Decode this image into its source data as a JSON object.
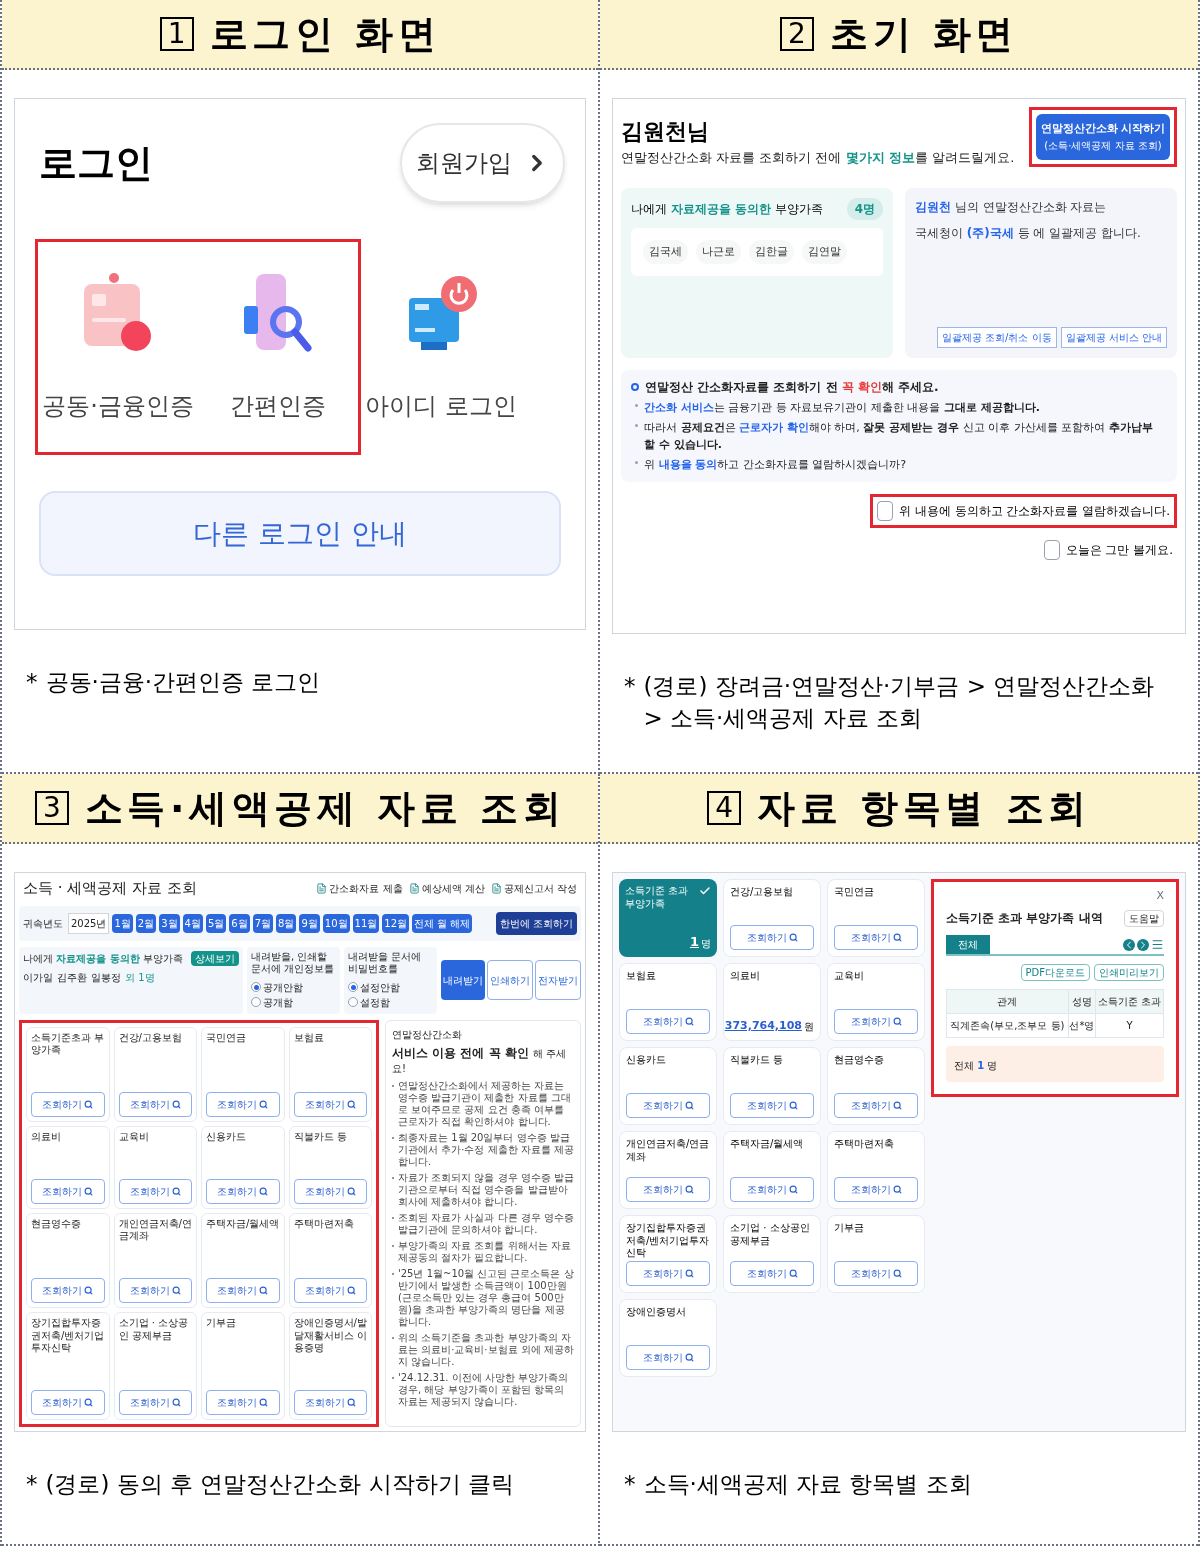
{
  "login_screen": {
    "number": "1",
    "title": "로그인 화면",
    "heading": "로그인",
    "signup_button": "회원가입",
    "method_groups": [
      {
        "highlighted": true,
        "methods": [
          {
            "label": "공동·금융인증",
            "kind": "certificate"
          },
          {
            "label": "간편인증",
            "kind": "simple"
          }
        ]
      },
      {
        "highlighted": false,
        "methods": [
          {
            "label": "아이디 로그인",
            "kind": "id"
          }
        ]
      }
    ],
    "other_login_button": "다른 로그인 안내",
    "caption": {
      "mark": "*",
      "text": "공동·금융·간편인증 로그인"
    }
  },
  "start_screen": {
    "number": "2",
    "title": "초기 화면",
    "greeting": "김원천님",
    "intro": [
      {
        "text": "연말정산간소화 자료를 조회하기 전에 "
      },
      {
        "text": "몇가지 정보",
        "color": "#14938a"
      },
      {
        "text": "를 알려드릴게요."
      }
    ],
    "start_button": {
      "label": "연말정산간소화 시작하기",
      "sublabel": "(소득·세액공제 자료 조회)",
      "highlighted": true
    },
    "dependents": {
      "heading": [
        {
          "text": "나에게 "
        },
        {
          "text": "자료제공을 동의한",
          "color": "#14938a"
        },
        {
          "text": " 부양가족"
        }
      ],
      "count": "4명",
      "names": [
        "김국세",
        "나근로",
        "김한글",
        "김연말"
      ]
    },
    "provider": {
      "lines": [
        [
          {
            "text": "김원천",
            "color": "#2563eb"
          },
          {
            "text": " 님의 연말정산간소화 자료는"
          }
        ],
        [
          {
            "text": "국세청이 "
          },
          {
            "text": "(주)국세",
            "color": "#2563eb"
          },
          {
            "text": "  등 에 일괄제공 합니다."
          }
        ]
      ],
      "buttons": [
        "일괄제공 조회/취소 이동",
        "일괄제공 서비스 안내"
      ]
    },
    "notice": {
      "heading": [
        {
          "text": "연말정산 간소화자료를 조회하기 전 ",
          "bold": true
        },
        {
          "text": "꼭 확인",
          "color": "#e53935"
        },
        {
          "text": "해 주세요.",
          "bold": true
        }
      ],
      "bullets": [
        [
          {
            "text": "간소화 서비스",
            "color": "#2563eb"
          },
          {
            "text": "는 금융기관 등 자료보유기관이 제출한 내용을 "
          },
          {
            "text": "그대로 제공합니다.",
            "bold": true
          }
        ],
        [
          {
            "text": "따라서 "
          },
          {
            "text": "공제요건",
            "bold": true
          },
          {
            "text": "은 "
          },
          {
            "text": "근로자가 확인",
            "color": "#2563eb"
          },
          {
            "text": "해야 하며, "
          },
          {
            "text": "잘못 공제받는 경우",
            "bold": true
          },
          {
            "text": " 신고 이후 가산세를 포함하여 "
          },
          {
            "text": "추가납부 할 수 있습니다.",
            "bold": true
          }
        ],
        [
          {
            "text": "위 "
          },
          {
            "text": "내용을 동의",
            "color": "#2563eb"
          },
          {
            "text": "하고 간소화자료를 열람하시겠습니까?"
          }
        ]
      ]
    },
    "consents": [
      {
        "label": "위 내용에 동의하고 간소화자료를 열람하겠습니다.",
        "checked": false,
        "highlighted": true
      },
      {
        "label": "오늘은 그만 볼게요.",
        "checked": false,
        "highlighted": false
      }
    ],
    "caption": {
      "mark": "*",
      "text": "(경로) 장려금·연말정산·기부금 > 연말정산간소화 > 소득·세액공제 자료 조회"
    }
  },
  "lookup_screen": {
    "number": "3",
    "title": "소득·세액공제 자료 조회",
    "heading": "소득 · 세액공제 자료 조회",
    "links": [
      "간소화자료 제출",
      "예상세액 계산",
      "공제신고서 작성"
    ],
    "year": {
      "label": "귀속년도",
      "value": "2025년",
      "months": [
        {
          "label": "1월",
          "selected": true
        },
        {
          "label": "2월",
          "selected": true
        },
        {
          "label": "3월",
          "selected": true
        },
        {
          "label": "4월",
          "selected": true
        },
        {
          "label": "5월",
          "selected": true
        },
        {
          "label": "6월",
          "selected": true
        },
        {
          "label": "7월",
          "selected": true
        },
        {
          "label": "8월",
          "selected": true
        },
        {
          "label": "9월",
          "selected": true
        },
        {
          "label": "10월",
          "selected": true
        },
        {
          "label": "11월",
          "selected": true
        },
        {
          "label": "12월",
          "selected": true
        }
      ],
      "clear_button": "전체 월 해제",
      "lookup_all_button": "한번에 조회하기"
    },
    "dependents": {
      "heading": [
        {
          "text": "나에게 "
        },
        {
          "text": "자료제공을 동의한",
          "color": "#14938a"
        },
        {
          "text": " 부양가족"
        }
      ],
      "detail_button": "상세보기",
      "names": [
        "이가일",
        "김주환",
        "일봉정"
      ],
      "more": "외 1명"
    },
    "options": [
      {
        "label": "내려받을, 인쇄할 문서에 개인정보를",
        "choices": [
          {
            "label": "공개안함",
            "selected": true
          },
          {
            "label": "공개함",
            "selected": false
          }
        ]
      },
      {
        "label": "내려받을 문서에 비밀번호를",
        "choices": [
          {
            "label": "설정안함",
            "selected": true
          },
          {
            "label": "설정함",
            "selected": false
          }
        ]
      }
    ],
    "actions": [
      {
        "label": "내려받기",
        "kind": "primary"
      },
      {
        "label": "인쇄하기",
        "kind": "outline"
      },
      {
        "label": "전자받기",
        "kind": "outline"
      }
    ],
    "items_highlighted": true,
    "items": [
      {
        "title": "소득기준초과 부양가족",
        "button": "조회하기"
      },
      {
        "title": "건강/고용보험",
        "button": "조회하기"
      },
      {
        "title": "국민연금",
        "button": "조회하기"
      },
      {
        "title": "보험료",
        "button": "조회하기"
      },
      {
        "title": "의료비",
        "button": "조회하기"
      },
      {
        "title": "교육비",
        "button": "조회하기"
      },
      {
        "title": "신용카드",
        "button": "조회하기"
      },
      {
        "title": "직불카드 등",
        "button": "조회하기"
      },
      {
        "title": "현금영수증",
        "button": "조회하기"
      },
      {
        "title": "개인연금저축/연금계좌",
        "button": "조회하기"
      },
      {
        "title": "주택자금/월세액",
        "button": "조회하기"
      },
      {
        "title": "주택마련저축",
        "button": "조회하기"
      },
      {
        "title": "장기집합투자증권저축/벤처기업투자신탁",
        "button": "조회하기"
      },
      {
        "title": "소기업 · 소상공인 공제부금",
        "button": "조회하기"
      },
      {
        "title": "기부금",
        "button": "조회하기"
      },
      {
        "title": "장애인증명서/발달재활서비스 이용증명",
        "button": "조회하기"
      }
    ],
    "notice": {
      "subtitle": "연말정산간소화",
      "title": "서비스 이용 전에 꼭 확인",
      "title_suffix": "해 주세요!",
      "bullets": [
        "연말정산간소화에서 제공하는 자료는 영수증 발급기관이 제출한 자료를 그대로 보여주므로 공제 요건 충족 여부를 근로자가 직접 확인하셔야 합니다.",
        "최종자료는 1월 20일부터 영수증 발급기관에서 추가·수정 제출한 자료를 제공합니다.",
        "자료가 조회되지 않을 경우 영수증 발급기관으로부터 직접 영수증을 발급받아 회사에 제출하셔야 합니다.",
        "조회된 자료가 사실과 다른 경우 영수증 발급기관에 문의하셔야 합니다.",
        "부양가족의 자료 조회를 위해서는 자료제공동의 절차가 필요합니다.",
        "'25년 1월~10월 신고된 근로소득은 상반기에서 발생한 소득금액이 100만원(근로소득만 있는 경우 총급여 500만원)을 초과한 부양가족의 명단을 제공합니다.",
        "위의 소득기준을 초과한 부양가족의 자료는 의료비·교육비·보험료 외에 제공하지 않습니다.",
        "'24.12.31. 이전에 사망한 부양가족의 경우, 해당 부양가족이 포함된 항목의 자료는 제공되지 않습니다."
      ]
    },
    "caption": {
      "mark": "*",
      "text": "(경로) 동의 후 연말정산간소화 시작하기 클릭"
    }
  },
  "items_screen": {
    "number": "4",
    "title": "자료 항목별 조회",
    "items": [
      {
        "title": "소득기준 초과 부양가족",
        "kind": "count",
        "value": "1",
        "unit": "명",
        "selected": true
      },
      {
        "title": "건강/고용보험",
        "kind": "button",
        "button": "조회하기",
        "selected": false
      },
      {
        "title": "국민연금",
        "kind": "button",
        "button": "조회하기",
        "selected": false
      },
      {
        "title": "보험료",
        "kind": "button",
        "button": "조회하기",
        "selected": false
      },
      {
        "title": "의료비",
        "kind": "amount",
        "value": "373,764,108",
        "unit": "원",
        "selected": false
      },
      {
        "title": "교육비",
        "kind": "button",
        "button": "조회하기",
        "selected": false
      },
      {
        "title": "신용카드",
        "kind": "button",
        "button": "조회하기",
        "selected": false
      },
      {
        "title": "직불카드 등",
        "kind": "button",
        "button": "조회하기",
        "selected": false
      },
      {
        "title": "현금영수증",
        "kind": "button",
        "button": "조회하기",
        "selected": false
      },
      {
        "title": "개인연금저축/연금계좌",
        "kind": "button",
        "button": "조회하기",
        "selected": false
      },
      {
        "title": "주택자금/월세액",
        "kind": "button",
        "button": "조회하기",
        "selected": false
      },
      {
        "title": "주택마련저축",
        "kind": "button",
        "button": "조회하기",
        "selected": false
      },
      {
        "title": "장기집합투자증권저축/벤처기업투자신탁",
        "kind": "button",
        "button": "조회하기",
        "selected": false
      },
      {
        "title": "소기업 · 소상공인 공제부금",
        "kind": "button",
        "button": "조회하기",
        "selected": false
      },
      {
        "title": "기부금",
        "kind": "button",
        "button": "조회하기",
        "selected": false
      },
      {
        "title": "장애인증명서",
        "kind": "button",
        "button": "조회하기",
        "selected": false
      }
    ],
    "popup": {
      "highlighted": true,
      "close": "X",
      "title": "소득기준 초과 부양가족 내역",
      "help_button": "도움말",
      "tabs": [
        {
          "label": "전체",
          "selected": true
        }
      ],
      "buttons": [
        "PDF다운로드",
        "인쇄미리보기"
      ],
      "columns": [
        "관계",
        "성명",
        "소득기준 초과"
      ],
      "rows": [
        [
          "직계존속(부모,조부모 등)",
          "선*영",
          "Y"
        ]
      ],
      "total": [
        {
          "text": "전체 "
        },
        {
          "text": "1",
          "color": "#2563eb"
        },
        {
          "text": " 명"
        }
      ]
    },
    "caption": {
      "mark": "*",
      "text": "소득·세액공제 자료 항목별 조회"
    }
  }
}
